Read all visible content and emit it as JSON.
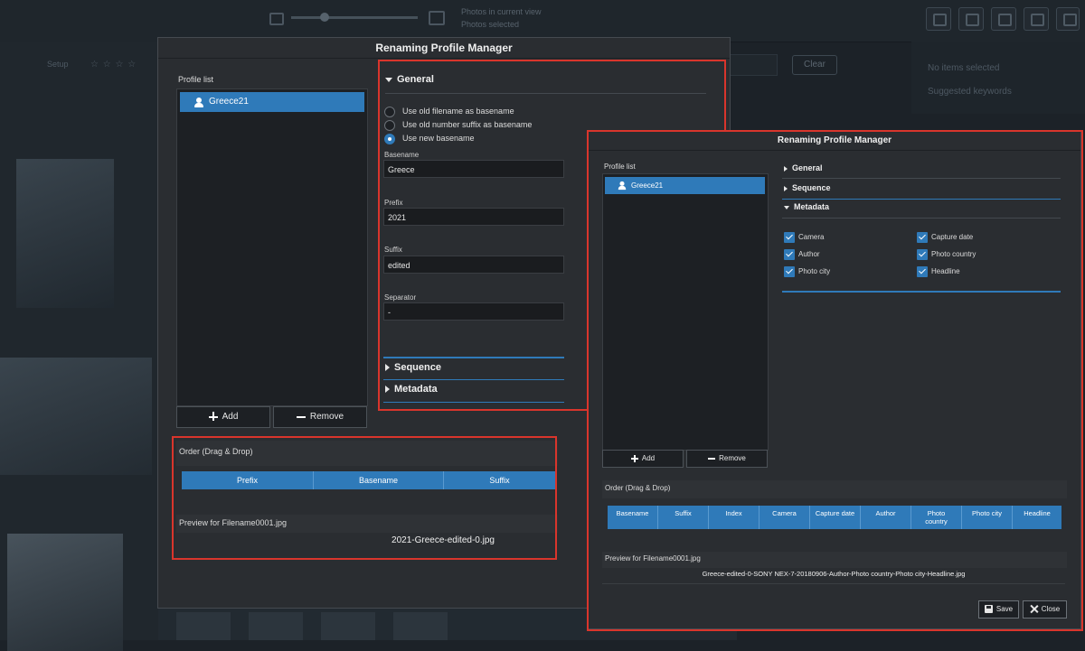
{
  "background": {
    "stats": [
      "Photos in current view",
      "Photos selected"
    ],
    "setup_label": "Setup",
    "clear_label": "Clear",
    "right_items": [
      "No items selected",
      "Suggested keywords"
    ]
  },
  "dialog_back": {
    "title": "Renaming Profile Manager",
    "profile_list_label": "Profile list",
    "profiles": [
      "Greece21"
    ],
    "add_label": "Add",
    "remove_label": "Remove",
    "general": {
      "header": "General",
      "radio_options": [
        "Use old filename as basename",
        "Use old number suffix as basename",
        "Use new basename"
      ],
      "selected_index": 2,
      "fields": [
        {
          "label": "Basename",
          "value": "Greece"
        },
        {
          "label": "Prefix",
          "value": "2021"
        },
        {
          "label": "Suffix",
          "value": "edited"
        },
        {
          "label": "Separator",
          "value": "-"
        }
      ]
    },
    "sections": [
      "Sequence",
      "Metadata"
    ],
    "order": {
      "label": "Order (Drag & Drop)",
      "columns": [
        "Prefix",
        "Basename",
        "Suffix"
      ]
    },
    "preview": {
      "label": "Preview for Filename0001.jpg",
      "value": "2021-Greece-edited-0.jpg"
    }
  },
  "dialog_front": {
    "title": "Renaming Profile Manager",
    "profile_list_label": "Profile list",
    "profiles": [
      "Greece21"
    ],
    "add_label": "Add",
    "remove_label": "Remove",
    "sections": {
      "general": "General",
      "sequence": "Sequence",
      "metadata": "Metadata"
    },
    "metadata_options": [
      {
        "label": "Camera",
        "checked": true
      },
      {
        "label": "Capture date",
        "checked": true
      },
      {
        "label": "Author",
        "checked": true
      },
      {
        "label": "Photo country",
        "checked": true
      },
      {
        "label": "Photo city",
        "checked": true
      },
      {
        "label": "Headline",
        "checked": true
      }
    ],
    "order": {
      "label": "Order (Drag & Drop)",
      "columns": [
        "Basename",
        "Suffix",
        "Index",
        "Camera",
        "Capture date",
        "Author",
        "Photo country",
        "Photo city",
        "Headline"
      ]
    },
    "preview": {
      "label": "Preview for Filename0001.jpg",
      "value": "Greece-edited-0-SONY NEX-7-20180906-Author-Photo country-Photo city-Headline.jpg"
    },
    "save_label": "Save",
    "close_label": "Close"
  },
  "colors": {
    "accent": "#2f7ab9",
    "highlight_border": "#d9352c",
    "dialog_bg": "#2a2d31",
    "panel_bg": "#1d2024"
  }
}
